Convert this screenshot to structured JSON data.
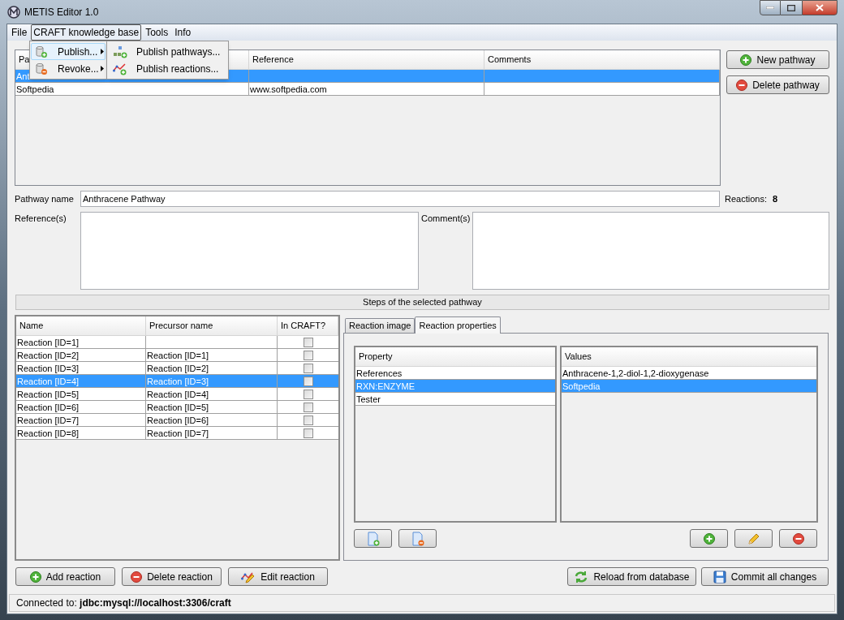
{
  "window": {
    "title": "METIS Editor 1.0"
  },
  "menu_bar": [
    {
      "label": "File",
      "selected": false
    },
    {
      "label": "CRAFT knowledge base",
      "selected": true
    },
    {
      "label": "Tools",
      "selected": false
    },
    {
      "label": "Info",
      "selected": false
    }
  ],
  "menu": {
    "items": [
      {
        "label": "Publish...",
        "kind": "add",
        "selected": true,
        "has_submenu": true
      },
      {
        "label": "Revoke...",
        "kind": "remove",
        "selected": false,
        "has_submenu": true
      }
    ]
  },
  "submenu": {
    "items": [
      {
        "label": "Publish pathways...",
        "kind": "pathways",
        "selected": false
      },
      {
        "label": "Publish reactions...",
        "kind": "reactions",
        "selected": false
      }
    ]
  },
  "pathways": {
    "columns": [
      "Pa",
      "Reference",
      "Comments"
    ],
    "rows": [
      {
        "name": "Ant",
        "selected": true
      },
      {
        "name": "Softpedia",
        "reference": "www.softpedia.com",
        "selected": false
      }
    ]
  },
  "pathway_buttons": [
    {
      "label": "New pathway",
      "kind": "add"
    },
    {
      "label": "Delete pathway",
      "kind": "remove"
    }
  ],
  "pathway_name": {
    "label": "Pathway name",
    "value": "Anthracene Pathway"
  },
  "reactions_count": {
    "label": "Reactions:",
    "value": "8"
  },
  "references": {
    "label": "Reference(s)"
  },
  "comments": {
    "label": "Comment(s)"
  },
  "steps_header": "Steps of the selected pathway",
  "reactions": {
    "columns": [
      "Name",
      "Precursor name",
      "In CRAFT?"
    ],
    "rows": [
      {
        "name": "Reaction [ID=1]",
        "in_craft": false,
        "selected": false
      },
      {
        "name": "Reaction [ID=2]",
        "precursor": "Reaction [ID=1]",
        "in_craft": false,
        "selected": false
      },
      {
        "name": "Reaction [ID=3]",
        "precursor": "Reaction [ID=2]",
        "in_craft": false,
        "selected": false
      },
      {
        "name": "Reaction [ID=4]",
        "precursor": "Reaction [ID=3]",
        "in_craft": false,
        "selected": true
      },
      {
        "name": "Reaction [ID=5]",
        "precursor": "Reaction [ID=4]",
        "in_craft": false,
        "selected": false
      },
      {
        "name": "Reaction [ID=6]",
        "precursor": "Reaction [ID=5]",
        "in_craft": false,
        "selected": false
      },
      {
        "name": "Reaction [ID=7]",
        "precursor": "Reaction [ID=6]",
        "in_craft": false,
        "selected": false
      },
      {
        "name": "Reaction [ID=8]",
        "precursor": "Reaction [ID=7]",
        "in_craft": false,
        "selected": false
      }
    ]
  },
  "tabs": [
    {
      "label": "Reaction image",
      "selected": false
    },
    {
      "label": "Reaction properties",
      "selected": true
    }
  ],
  "properties": {
    "column": "Property",
    "rows": [
      {
        "label": "References",
        "selected": false
      },
      {
        "label": "RXN:ENZYME",
        "selected": true
      },
      {
        "label": "Tester",
        "selected": false
      }
    ]
  },
  "values": {
    "column": "Values",
    "rows": [
      {
        "label": "Anthracene-1,2-diol-1,2-dioxygenase",
        "selected": false
      },
      {
        "label": "Softpedia",
        "selected": true
      }
    ]
  },
  "property_buttons": [
    {
      "kind": "add-file"
    },
    {
      "kind": "remove-file"
    }
  ],
  "value_buttons": [
    {
      "kind": "add"
    },
    {
      "kind": "edit"
    },
    {
      "kind": "remove"
    }
  ],
  "reaction_buttons": [
    {
      "label": "Add reaction",
      "kind": "add"
    },
    {
      "label": "Delete reaction",
      "kind": "remove"
    },
    {
      "label": "Edit reaction",
      "kind": "edit-reaction"
    }
  ],
  "database_buttons": [
    {
      "label": "Reload from database",
      "kind": "reload"
    },
    {
      "label": "Commit all changes",
      "kind": "save"
    }
  ],
  "status_bar": "Connected to: **jdbc:mysql://localhost:3306/craft**"
}
